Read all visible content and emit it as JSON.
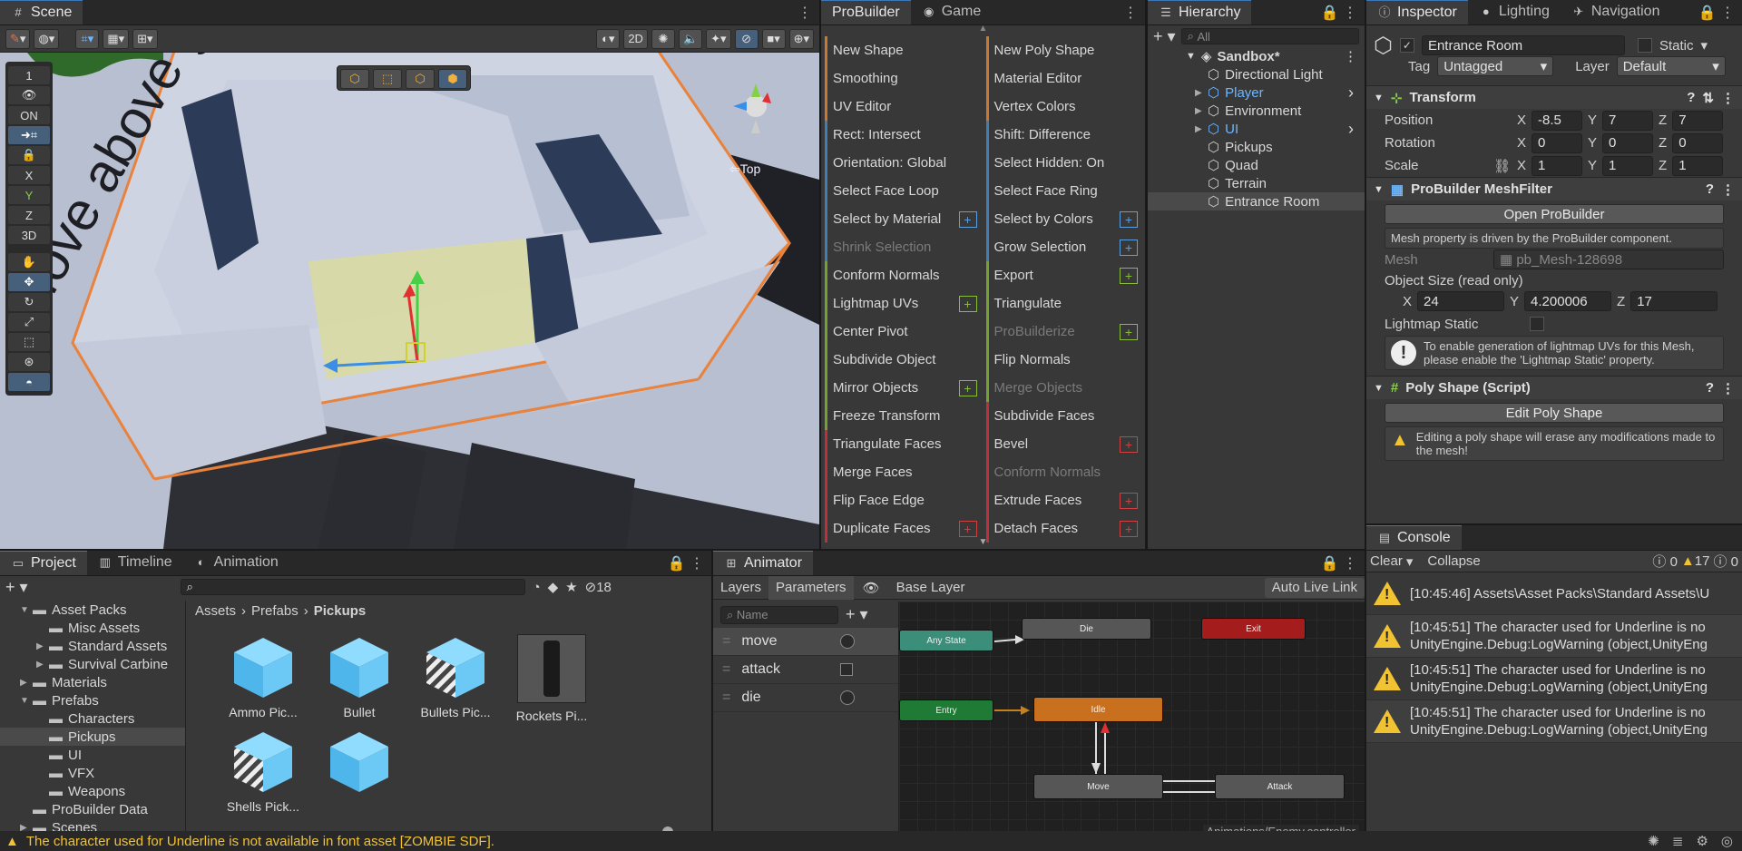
{
  "scene": {
    "tab": "Scene",
    "mode_2d": "2D",
    "top_label": "⇦Top",
    "gizmo_vertical_text": "Move above ground",
    "side_tool_number": "1",
    "side_on": "ON",
    "axes": [
      "X",
      "Y",
      "Z"
    ],
    "mode_3d": "3D"
  },
  "probuilder": {
    "tabs": [
      "ProBuilder",
      "Game"
    ],
    "left": [
      {
        "label": "New Shape",
        "color": "orange"
      },
      {
        "label": "Smoothing",
        "color": "orange"
      },
      {
        "label": "UV Editor",
        "color": "orange"
      },
      {
        "label": "Rect: Intersect",
        "color": "blue"
      },
      {
        "label": "Orientation: Global",
        "color": "blue"
      },
      {
        "label": "Select Face Loop",
        "color": "blue"
      },
      {
        "label": "Select by Material",
        "color": "blue",
        "plus": "blue"
      },
      {
        "label": "Shrink Selection",
        "color": "blue",
        "disabled": true
      },
      {
        "label": "Conform Normals",
        "color": "green"
      },
      {
        "label": "Lightmap UVs",
        "color": "green",
        "plus": "green"
      },
      {
        "label": "Center Pivot",
        "color": "green"
      },
      {
        "label": "Subdivide Object",
        "color": "green"
      },
      {
        "label": "Mirror Objects",
        "color": "green",
        "plus": "green"
      },
      {
        "label": "Freeze Transform",
        "color": "green"
      },
      {
        "label": "Triangulate Faces",
        "color": "red"
      },
      {
        "label": "Merge Faces",
        "color": "red"
      },
      {
        "label": "Flip Face Edge",
        "color": "red"
      },
      {
        "label": "Duplicate Faces",
        "color": "red",
        "plus": "red"
      }
    ],
    "right": [
      {
        "label": "New Poly Shape",
        "color": "orange"
      },
      {
        "label": "Material Editor",
        "color": "orange"
      },
      {
        "label": "Vertex Colors",
        "color": "orange"
      },
      {
        "label": "Shift: Difference",
        "color": "blue"
      },
      {
        "label": "Select Hidden: On",
        "color": "blue"
      },
      {
        "label": "Select Face Ring",
        "color": "blue"
      },
      {
        "label": "Select by Colors",
        "color": "blue",
        "plus": "blue"
      },
      {
        "label": "Grow Selection",
        "color": "blue",
        "plus": "blue"
      },
      {
        "label": "Export",
        "color": "green",
        "plus": "green"
      },
      {
        "label": "Triangulate",
        "color": "green"
      },
      {
        "label": "ProBuilderize",
        "color": "green",
        "disabled": true,
        "plus": "green"
      },
      {
        "label": "Flip Normals",
        "color": "green"
      },
      {
        "label": "Merge Objects",
        "color": "green",
        "disabled": true
      },
      {
        "label": "Subdivide Faces",
        "color": "red"
      },
      {
        "label": "Bevel",
        "color": "red",
        "plus": "red"
      },
      {
        "label": "Conform Normals",
        "color": "red",
        "disabled": true
      },
      {
        "label": "Extrude Faces",
        "color": "red",
        "plus": "red"
      },
      {
        "label": "Detach Faces",
        "color": "red",
        "plus": "red"
      }
    ]
  },
  "hierarchy": {
    "tab": "Hierarchy",
    "search_placeholder": "All",
    "root": "Sandbox*",
    "items": [
      {
        "label": "Directional Light",
        "arrow": false,
        "blue": false,
        "more": false
      },
      {
        "label": "Player",
        "arrow": true,
        "blue": true,
        "more": true
      },
      {
        "label": "Environment",
        "arrow": true,
        "blue": false,
        "more": false
      },
      {
        "label": "UI",
        "arrow": true,
        "blue": true,
        "more": true
      },
      {
        "label": "Pickups",
        "arrow": false,
        "blue": false,
        "more": false
      },
      {
        "label": "Quad",
        "arrow": false,
        "blue": false,
        "more": false
      },
      {
        "label": "Terrain",
        "arrow": false,
        "blue": false,
        "more": false
      },
      {
        "label": "Entrance Room",
        "arrow": false,
        "blue": false,
        "more": false,
        "selected": true
      }
    ]
  },
  "inspector": {
    "tabs": [
      "Inspector",
      "Lighting",
      "Navigation"
    ],
    "object_name": "Entrance Room",
    "static_label": "Static",
    "tag_label": "Tag",
    "tag_value": "Untagged",
    "layer_label": "Layer",
    "layer_value": "Default",
    "transform": {
      "title": "Transform",
      "rows": [
        {
          "label": "Position",
          "x": "-8.5",
          "y": "7",
          "z": "7"
        },
        {
          "label": "Rotation",
          "x": "0",
          "y": "0",
          "z": "0"
        },
        {
          "label": "Scale",
          "x": "1",
          "y": "1",
          "z": "1"
        }
      ]
    },
    "meshfilter": {
      "title": "ProBuilder MeshFilter",
      "open_button": "Open ProBuilder",
      "driven_note": "Mesh property is driven by the ProBuilder component.",
      "mesh_label": "Mesh",
      "mesh_value": "pb_Mesh-128698",
      "size_label": "Object Size (read only)",
      "size_x": "24",
      "size_y": "4.200006",
      "size_z": "17",
      "lightmap_label": "Lightmap Static",
      "lightmap_help": "To enable generation of lightmap UVs for this Mesh, please enable the 'Lightmap Static' property."
    },
    "polyshape": {
      "title": "Poly Shape (Script)",
      "button": "Edit Poly Shape",
      "help": "Editing a poly shape will erase any modifications made to the mesh!"
    }
  },
  "console": {
    "tab": "Console",
    "clear": "Clear",
    "collapse": "Collapse",
    "count_info": "0",
    "count_warn": "17",
    "count_err": "0",
    "rows": [
      {
        "l1": "[10:45:46] Assets\\Asset Packs\\Standard Assets\\U",
        "l2": ""
      },
      {
        "l1": "[10:45:51] The character used for Underline is no",
        "l2": "UnityEngine.Debug:LogWarning (object,UnityEng"
      },
      {
        "l1": "[10:45:51] The character used for Underline is no",
        "l2": "UnityEngine.Debug:LogWarning (object,UnityEng"
      },
      {
        "l1": "[10:45:51] The character used for Underline is no",
        "l2": "UnityEngine.Debug:LogWarning (object,UnityEng"
      }
    ]
  },
  "project": {
    "tabs": [
      "Project",
      "Timeline",
      "Animation"
    ],
    "hidden_count": "18",
    "tree": [
      {
        "label": "Asset Packs",
        "indent": 1,
        "arrow": "open"
      },
      {
        "label": "Misc Assets",
        "indent": 2,
        "arrow": ""
      },
      {
        "label": "Standard Assets",
        "indent": 2,
        "arrow": "closed"
      },
      {
        "label": "Survival Carbine",
        "indent": 2,
        "arrow": "closed"
      },
      {
        "label": "Materials",
        "indent": 1,
        "arrow": "closed"
      },
      {
        "label": "Prefabs",
        "indent": 1,
        "arrow": "open"
      },
      {
        "label": "Characters",
        "indent": 2,
        "arrow": ""
      },
      {
        "label": "Pickups",
        "indent": 2,
        "arrow": "",
        "selected": true
      },
      {
        "label": "UI",
        "indent": 2,
        "arrow": ""
      },
      {
        "label": "VFX",
        "indent": 2,
        "arrow": ""
      },
      {
        "label": "Weapons",
        "indent": 2,
        "arrow": ""
      },
      {
        "label": "ProBuilder Data",
        "indent": 1,
        "arrow": ""
      },
      {
        "label": "Scenes",
        "indent": 1,
        "arrow": "closed"
      }
    ],
    "breadcrumb": [
      "Assets",
      "Prefabs",
      "Pickups"
    ],
    "assets": [
      {
        "label": "Ammo Pic...",
        "kind": "cube"
      },
      {
        "label": "Bullet",
        "kind": "cube"
      },
      {
        "label": "Bullets Pic...",
        "kind": "striped"
      },
      {
        "label": "Rockets Pi...",
        "kind": "rocket"
      },
      {
        "label": "Shells Pick...",
        "kind": "striped"
      },
      {
        "label": "",
        "kind": "cube"
      }
    ]
  },
  "animator": {
    "tab": "Animator",
    "layers_tab": "Layers",
    "params_tab": "Parameters",
    "base_layer": "Base Layer",
    "auto_live": "Auto Live Link",
    "name_placeholder": "Name",
    "params": [
      {
        "name": "move",
        "type": "trigger"
      },
      {
        "name": "attack",
        "type": "bool"
      },
      {
        "name": "die",
        "type": "trigger"
      }
    ],
    "nodes": {
      "any_state": "Any State",
      "die": "Die",
      "exit": "Exit",
      "entry": "Entry",
      "idle": "Idle",
      "move": "Move",
      "attack": "Attack"
    },
    "controller_path": "Animations/Enemy.controller"
  },
  "status": {
    "message": "The character used for Underline is not available in font asset [ZOMBIE SDF]."
  }
}
